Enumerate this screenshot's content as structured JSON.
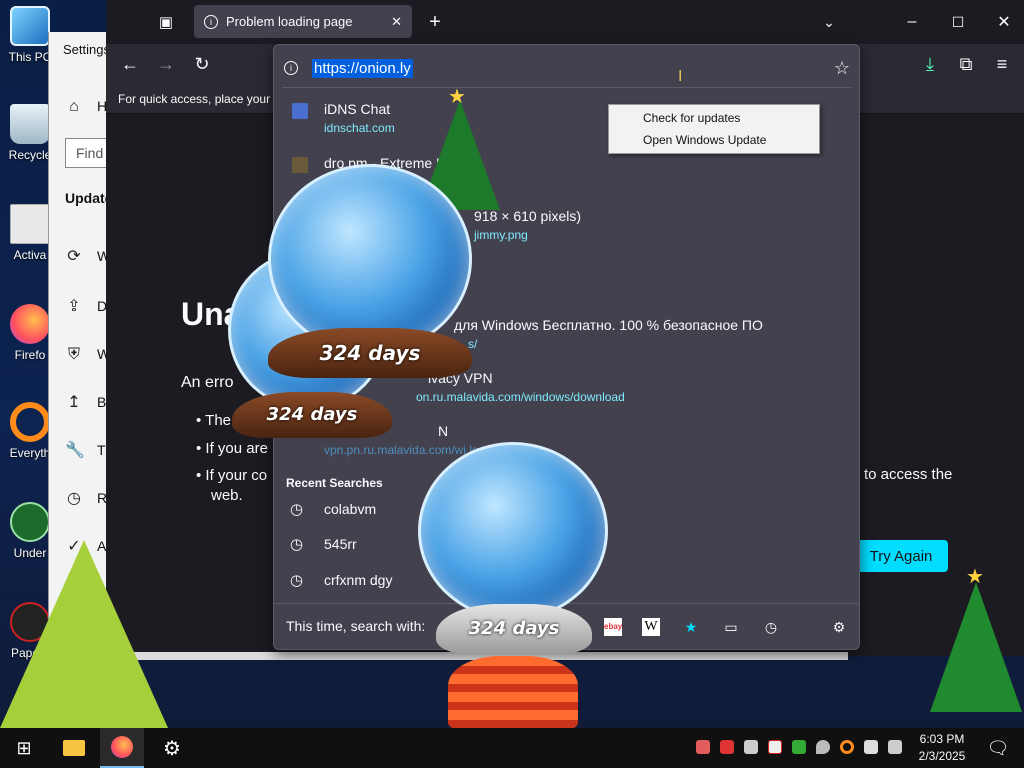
{
  "desktop": {
    "icons": [
      {
        "label": "This PC"
      },
      {
        "label": "Recycle"
      },
      {
        "label": "Activa"
      },
      {
        "label": "Firefo"
      },
      {
        "label": "Everyth"
      },
      {
        "label": "Under"
      },
      {
        "label": "Papers"
      }
    ]
  },
  "settings": {
    "title": "Settings",
    "home_label": "H",
    "find_placeholder": "Find",
    "section": "Update",
    "items": [
      {
        "icon": "refresh-icon",
        "label": "W"
      },
      {
        "icon": "upload-icon",
        "label": "D"
      },
      {
        "icon": "shield-icon",
        "label": "W"
      },
      {
        "icon": "backup-icon",
        "label": "Ba"
      },
      {
        "icon": "wrench-icon",
        "label": "Tr"
      },
      {
        "icon": "history-icon",
        "label": "Re"
      },
      {
        "icon": "check-circle-icon",
        "label": "A"
      }
    ]
  },
  "browser": {
    "tab_title": "Problem loading page",
    "bookmarks_text": "For quick access, place your b",
    "url": "https://onion.ly",
    "error": {
      "title": "Una",
      "subtitle": "An erro",
      "bullets": [
        "The",
        "If you are",
        "If your co"
      ],
      "bullet3_tail": "to access the",
      "bullet3_line2": "web.",
      "try_again": "Try Again"
    },
    "suggestions": [
      {
        "title": "iDNS Chat",
        "url": "idnschat.com"
      },
      {
        "title": "dro.pm - Extreme      Links",
        "url": ""
      },
      {
        "title": "918 × 610 pixels)",
        "url": "jimmy.png"
      },
      {
        "title": "для Windows Бесплатно. 100 % безопасное ПО",
        "url": "s/"
      },
      {
        "title": "ivacy VPN",
        "url": "on.ru.malavida.com/windows/download"
      },
      {
        "title": "N",
        "url": "vpn.pn.ru.malavida.com/wi        load"
      }
    ],
    "recent_header": "Recent Searches",
    "recent_searches": [
      "colabvm",
      "545rr",
      "crfxnm dgy"
    ],
    "search_with": "This time, search with:"
  },
  "context_menu": {
    "items": [
      "Check for updates",
      "Open Windows Update"
    ]
  },
  "decorations": {
    "globe_label": "324 days"
  },
  "taskbar": {
    "time": "6:03 PM",
    "date": "2/3/2025"
  },
  "colors": {
    "accent": "#00ddff",
    "url_highlight": "#0060df",
    "link": "#80ebff"
  }
}
